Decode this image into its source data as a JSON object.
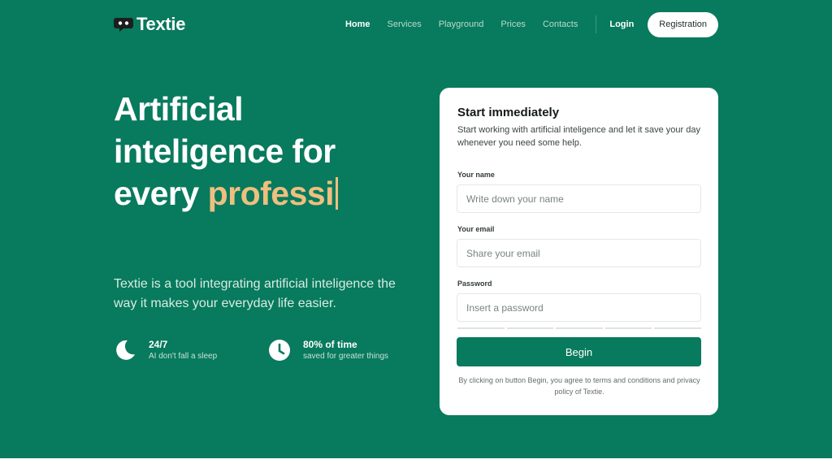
{
  "brand": {
    "name": "Textie"
  },
  "nav": {
    "items": [
      {
        "label": "Home",
        "active": true
      },
      {
        "label": "Services",
        "active": false
      },
      {
        "label": "Playground",
        "active": false
      },
      {
        "label": "Prices",
        "active": false
      },
      {
        "label": "Contacts",
        "active": false
      }
    ],
    "login": "Login",
    "register": "Registration"
  },
  "hero": {
    "title_line1": "Artificial",
    "title_line2": "inteligence for",
    "title_line3_prefix": "every ",
    "title_line3_typed": "professi",
    "description": "Textie is a tool integrating artificial inteligence the way it makes your everyday life easier."
  },
  "features": [
    {
      "icon": "moon-icon",
      "title": "24/7",
      "subtitle": "AI don't fall a sleep"
    },
    {
      "icon": "clock-icon",
      "title": "80% of time",
      "subtitle": "saved for greater things"
    }
  ],
  "form": {
    "title": "Start immediately",
    "subtitle": "Start working with artificial inteligence and let it save your day whenever you need some help.",
    "name_label": "Your name",
    "name_placeholder": "Write down your name",
    "email_label": "Your email",
    "email_placeholder": "Share your email",
    "password_label": "Password",
    "password_placeholder": "Insert a password",
    "submit": "Begin",
    "terms": "By clicking on button Begin, you agree to terms and conditions and privacy policy of Textie."
  },
  "colors": {
    "background": "#087a5d",
    "accent": "#efbf7f",
    "card": "#ffffff"
  }
}
